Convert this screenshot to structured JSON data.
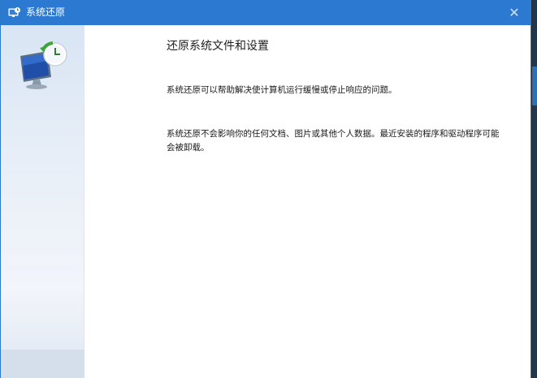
{
  "window": {
    "title": "系统还原",
    "title_icon": "system-restore-icon",
    "close_glyph": "✕"
  },
  "sidebar": {
    "icon": "system-restore-monitor-clock-icon"
  },
  "content": {
    "heading": "还原系统文件和设置",
    "paragraph1": "系统还原可以帮助解决使计算机运行缓慢或停止响应的问题。",
    "paragraph2": "系统还原不会影响你的任何文档、图片或其他个人数据。最近安装的程序和驱动程序可能会被卸载。"
  },
  "colors": {
    "titlebar": "#2b79d0",
    "sidebar": "#e3ebf6",
    "background": "#ffffff"
  }
}
